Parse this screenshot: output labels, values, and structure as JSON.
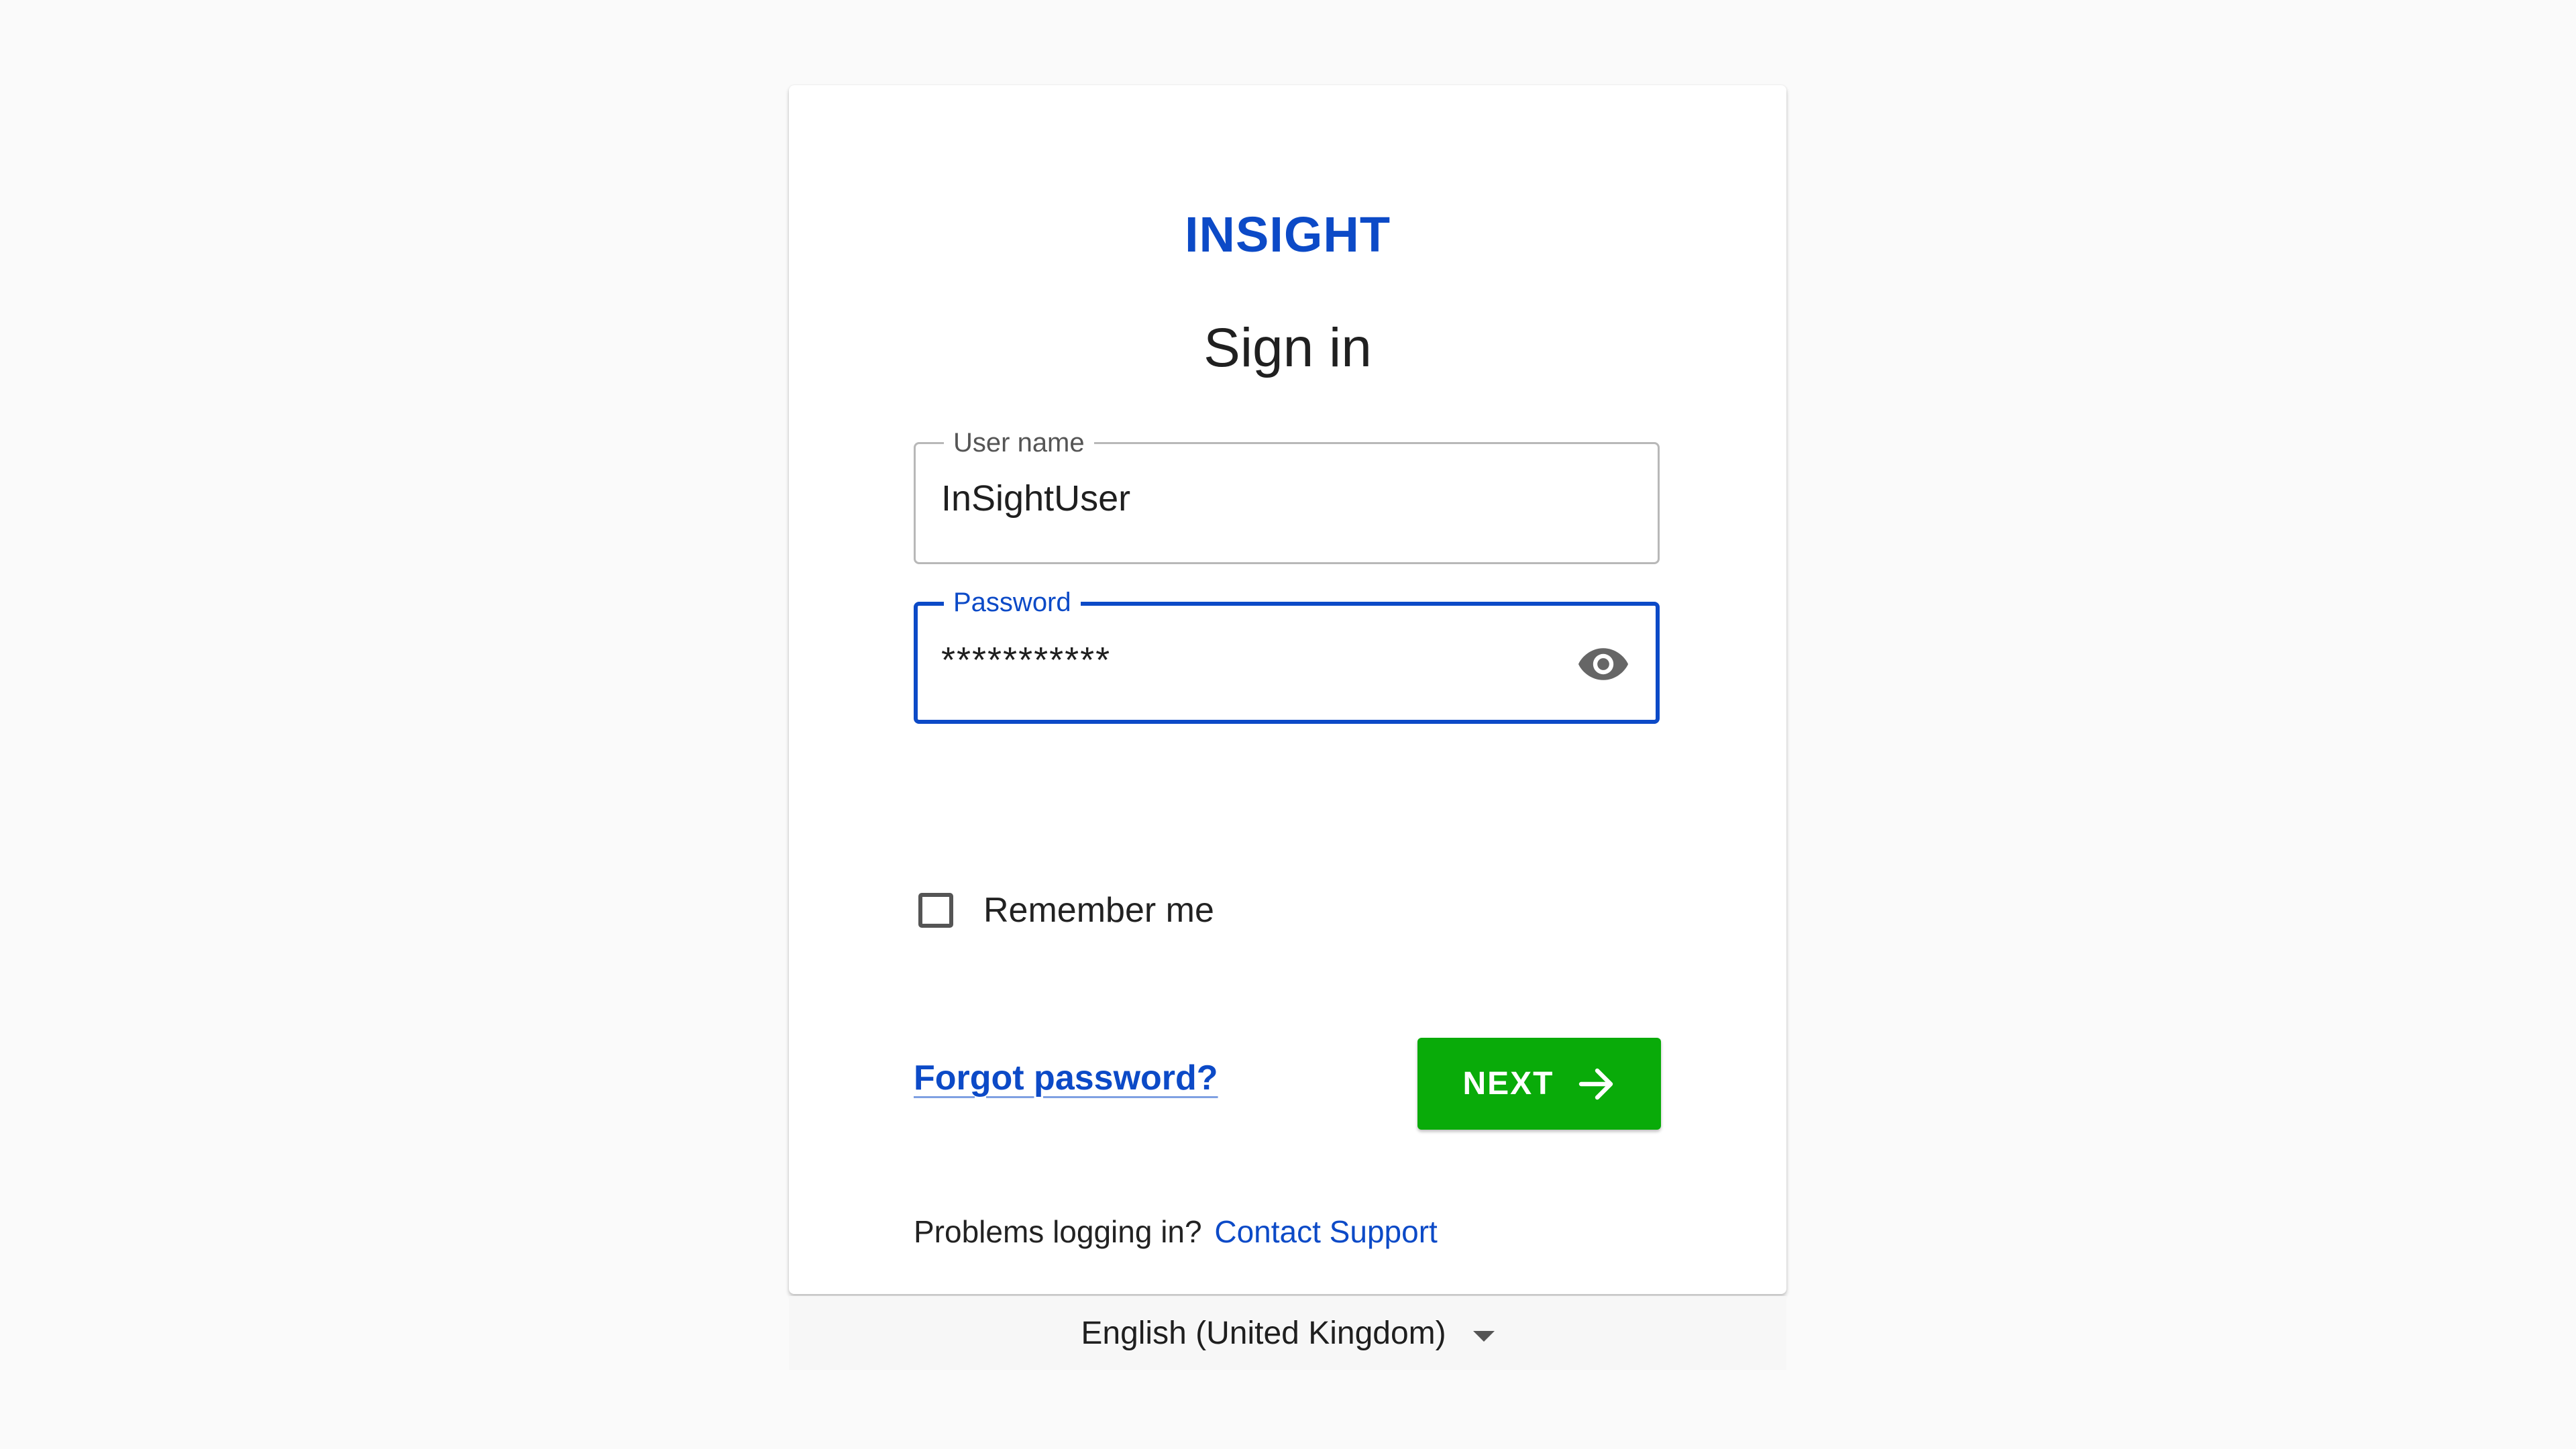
{
  "brand": {
    "name": "INSIGHT",
    "color": "#0c4ac7"
  },
  "form": {
    "title": "Sign in",
    "username": {
      "label": "User name",
      "value": "InSightUser"
    },
    "password": {
      "label": "Password",
      "value": "***********",
      "toggle_icon": "eye-icon"
    },
    "remember": {
      "label": "Remember me",
      "checked": false
    },
    "forgot_link": "Forgot password?",
    "next_button": {
      "label": "NEXT",
      "icon": "arrow-right-icon",
      "color": "#09ab09"
    },
    "help": {
      "text": "Problems logging in?",
      "link": "Contact Support"
    }
  },
  "language": {
    "selected": "English (United Kingdom)",
    "icon": "caret-down-icon"
  }
}
